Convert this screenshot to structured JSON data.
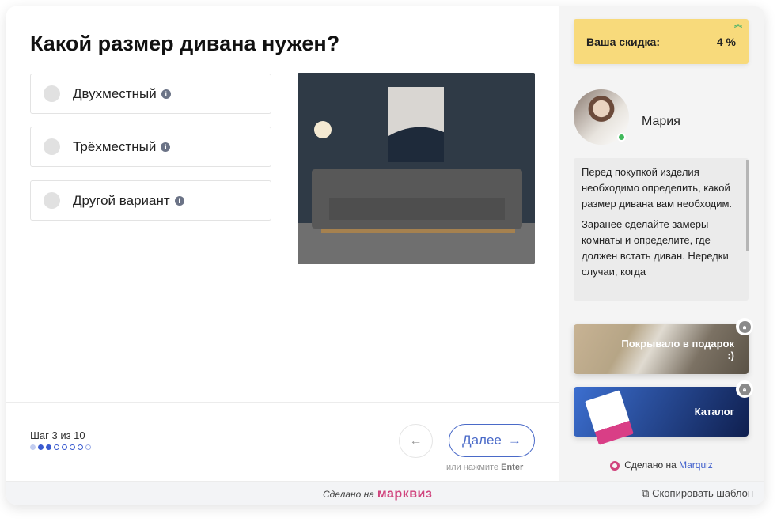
{
  "question": {
    "title": "Какой размер дивана нужен?",
    "options": [
      {
        "label": "Двухместный"
      },
      {
        "label": "Трёхместный"
      },
      {
        "label": "Другой вариант"
      }
    ]
  },
  "nav": {
    "step": "Шаг 3 из 10",
    "current_step": 3,
    "total_steps": 10,
    "back_icon": "←",
    "next_label": "Далее",
    "next_icon": "→",
    "hint_prefix": "или нажмите",
    "hint_key": "Enter"
  },
  "sidebar": {
    "discount_label": "Ваша скидка:",
    "discount_value": "4 %",
    "manager_name": "Мария",
    "message": [
      "Перед покупкой изделия необходимо определить, какой размер дивана вам необходим.",
      "Заранее сделайте замеры комнаты и определите, где должен встать диван. Нередки случаи, когда"
    ],
    "bonuses": [
      {
        "label": "Покрывало в подарок :)"
      },
      {
        "label": "Каталог"
      }
    ],
    "made_prefix": "Сделано на",
    "made_link": "Marquiz"
  },
  "footer": {
    "made_prefix": "Сделано на",
    "brand": "марквиз",
    "copy_label": "Скопировать шаблон"
  },
  "colors": {
    "accent": "#4a6ac8",
    "discount_bg": "#f8da7b",
    "brand": "#d0447d"
  }
}
